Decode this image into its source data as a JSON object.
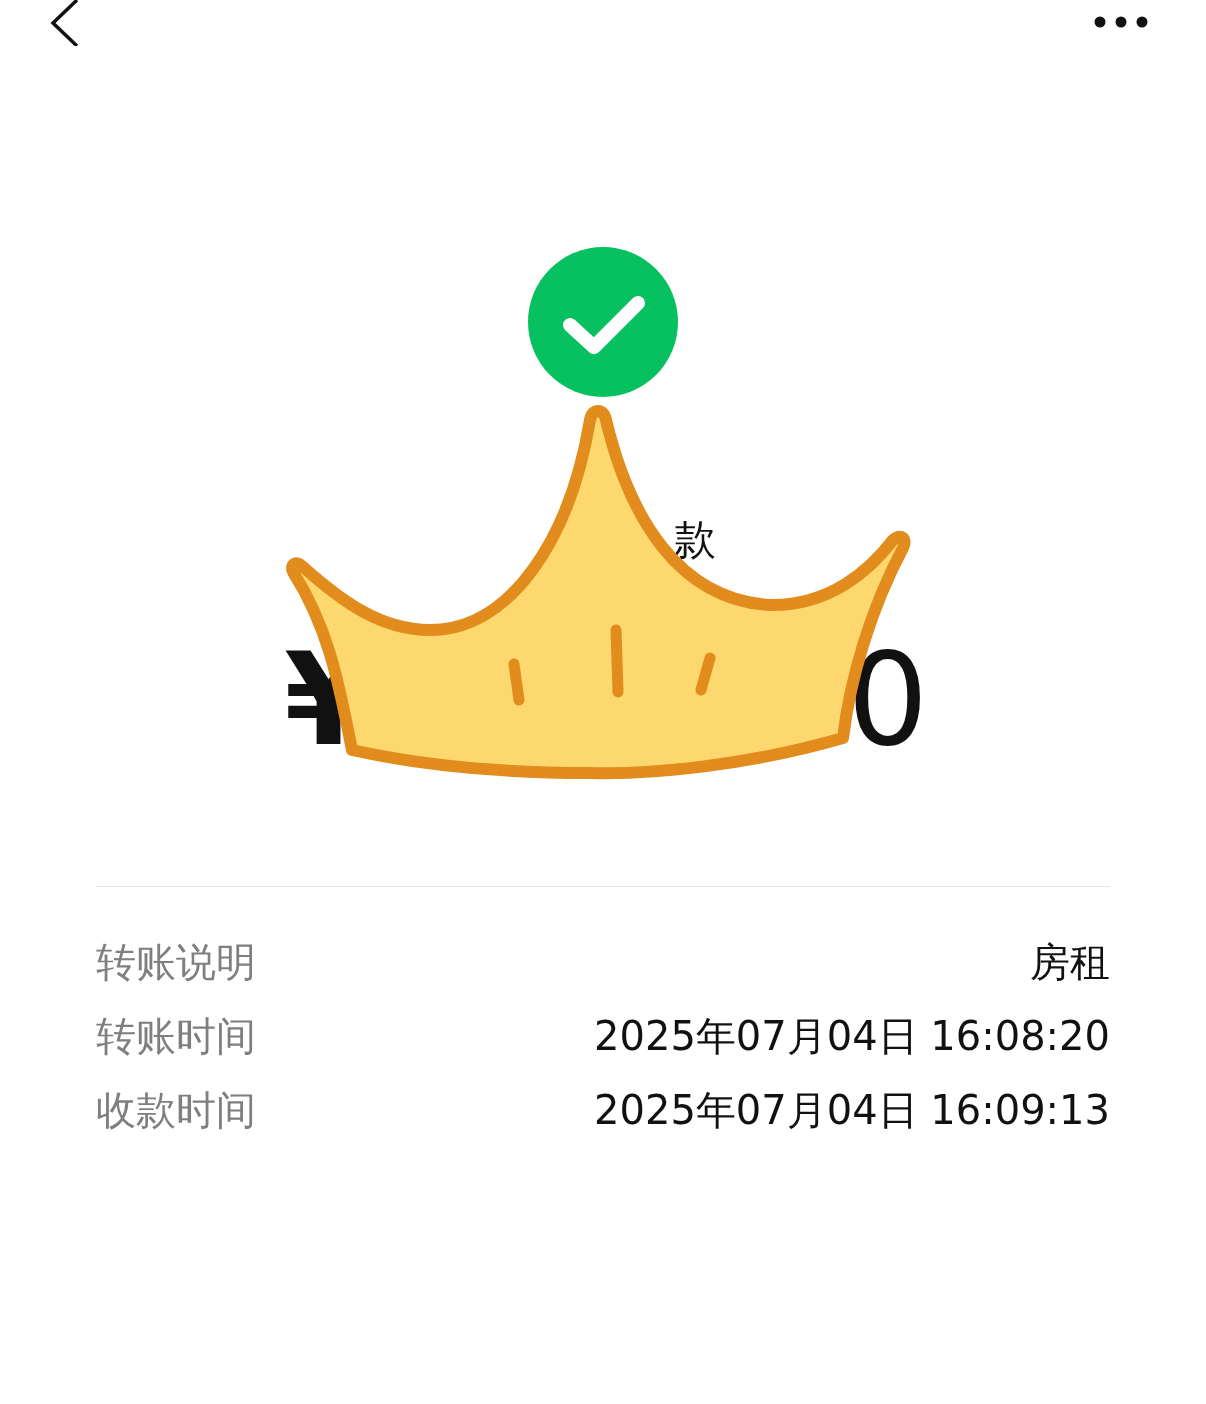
{
  "status": {
    "kind": "success"
  },
  "title": "款",
  "amount": {
    "currency": "¥",
    "tail": "0"
  },
  "details": [
    {
      "label": "转账说明",
      "value": "房租"
    },
    {
      "label": "转账时间",
      "value": "2025年07月04日 16:08:20"
    },
    {
      "label": "收款时间",
      "value": "2025年07月04日 16:09:13"
    }
  ]
}
